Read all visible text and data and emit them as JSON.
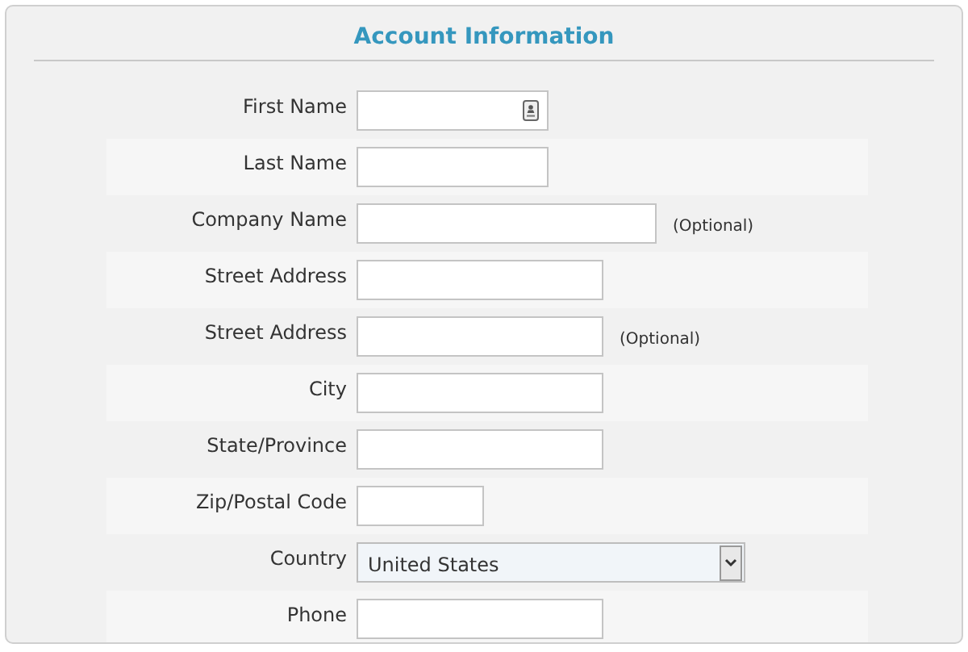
{
  "title": "Account Information",
  "fields": [
    {
      "label": "First Name",
      "kind": "text",
      "contact_icon": true
    },
    {
      "label": "Last Name",
      "kind": "text"
    },
    {
      "label": "Company Name",
      "kind": "text",
      "note": "(Optional)"
    },
    {
      "label": "Street Address",
      "kind": "text"
    },
    {
      "label": "Street Address",
      "kind": "text",
      "note": "(Optional)"
    },
    {
      "label": "City",
      "kind": "text"
    },
    {
      "label": "State/Province",
      "kind": "text"
    },
    {
      "label": "Zip/Postal Code",
      "kind": "text"
    },
    {
      "label": "Country",
      "kind": "select",
      "value": "United States"
    },
    {
      "label": "Phone",
      "kind": "text"
    }
  ]
}
